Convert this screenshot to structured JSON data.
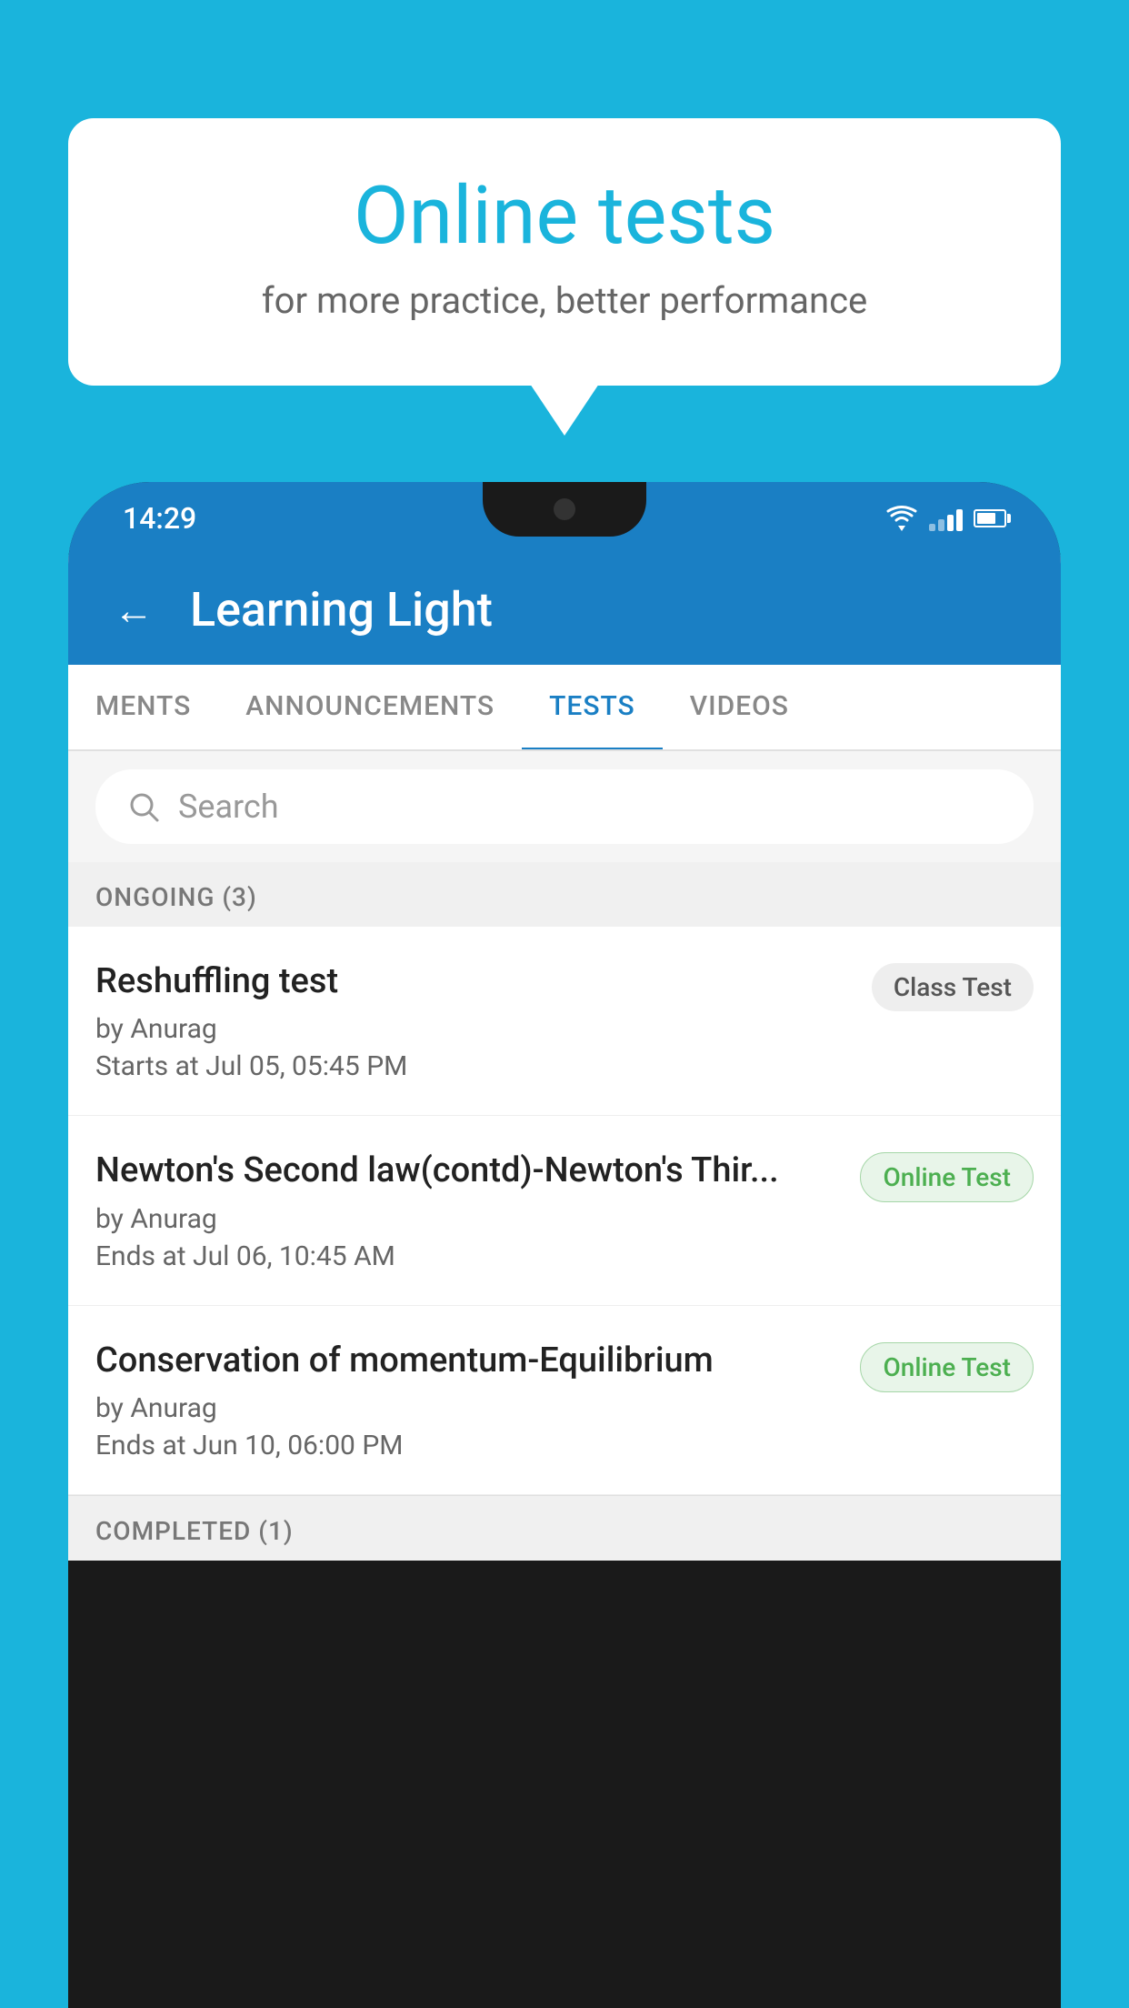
{
  "background_color": "#1ab4dc",
  "speech_bubble": {
    "title": "Online tests",
    "subtitle": "for more practice, better performance"
  },
  "phone": {
    "status_bar": {
      "time": "14:29",
      "wifi": "▼",
      "signal": "▲",
      "battery": "▓"
    },
    "app": {
      "header": {
        "back_label": "←",
        "title": "Learning Light"
      },
      "tabs": [
        {
          "label": "MENTS",
          "active": false
        },
        {
          "label": "ANNOUNCEMENTS",
          "active": false
        },
        {
          "label": "TESTS",
          "active": true
        },
        {
          "label": "VIDEOS",
          "active": false
        }
      ],
      "search": {
        "placeholder": "Search"
      },
      "sections": [
        {
          "header": "ONGOING (3)",
          "items": [
            {
              "title": "Reshuffling test",
              "author": "by Anurag",
              "time": "Starts at  Jul 05, 05:45 PM",
              "badge": "Class Test",
              "badge_type": "class"
            },
            {
              "title": "Newton's Second law(contd)-Newton's Thir...",
              "author": "by Anurag",
              "time": "Ends at  Jul 06, 10:45 AM",
              "badge": "Online Test",
              "badge_type": "online"
            },
            {
              "title": "Conservation of momentum-Equilibrium",
              "author": "by Anurag",
              "time": "Ends at  Jun 10, 06:00 PM",
              "badge": "Online Test",
              "badge_type": "online"
            }
          ]
        }
      ],
      "completed_section_header": "COMPLETED (1)"
    }
  }
}
